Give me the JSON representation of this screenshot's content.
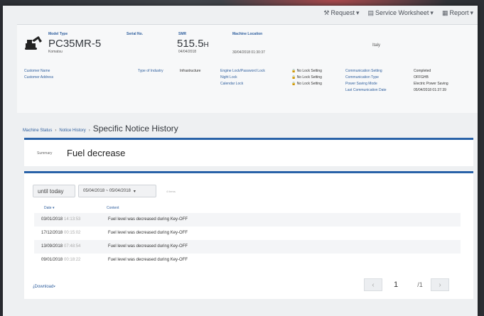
{
  "nav": {
    "request": "Request",
    "service_worksheet": "Service Worksheet",
    "report": "Report",
    "icons": [
      "wrench-icon",
      "document-icon",
      "report-icon",
      "caret-down-icon"
    ]
  },
  "machine": {
    "model_label": "Model Type",
    "model": "PC35MR-5",
    "maker": "Komatsu",
    "serial_label": "Serial No.",
    "smr_label": "SMR",
    "smr_value": "515.5",
    "smr_unit": "H",
    "smr_date": "04/04/2018",
    "location_label": "Machine Location",
    "location_date": "30/04/2018 01:30:37",
    "country": "Italy",
    "customer_name_label": "Customer Name",
    "customer_address_label": "Customer Address",
    "industry_label": "Type of Industry",
    "industry_value": "Infrastructure",
    "engine_lock_label": "Engine Lock/Password Lock",
    "night_lock_label": "Night Lock",
    "calendar_lock_label": "Calendar Lock",
    "lock_value": "No Lock Setting",
    "comm_setting_label": "Communication Setting",
    "comm_setting_value": "Completed",
    "comm_type_label": "Communication Type",
    "comm_type_value": "OFFGHB",
    "power_mode_label": "Power Saving Mode",
    "power_mode_value": "Electric Power Saving",
    "last_comm_label": "Last Communication Date",
    "last_comm_value": "05/04/2018 01:37:39"
  },
  "breadcrumb": {
    "machine_status": "Machine Status",
    "notice_history": "Notice History",
    "current": "Specific Notice History",
    "separator": "›"
  },
  "summary": {
    "label": "Summary",
    "value": "Fuel decrease"
  },
  "history": {
    "until_today": "until today",
    "range": "05/04/2018 ~ 05/04/2018",
    "items": "4 items",
    "col_date": "Date",
    "col_content": "Content",
    "rows": [
      {
        "date": "03/01/2018",
        "time": "14:13:53",
        "content": "Fuel level was decreased during Key-OFF"
      },
      {
        "date": "17/12/2018",
        "time": "00:15:02",
        "content": "Fuel level was decreased during Key-OFF"
      },
      {
        "date": "13/09/2018",
        "time": "07:48:54",
        "content": "Fuel level was decreased during Key-OFF"
      },
      {
        "date": "09/01/2018",
        "time": "00:18:22",
        "content": "Fuel level was decreased during Key-OFF"
      }
    ],
    "download": "Download",
    "page": "1",
    "total_pages": "/1"
  }
}
